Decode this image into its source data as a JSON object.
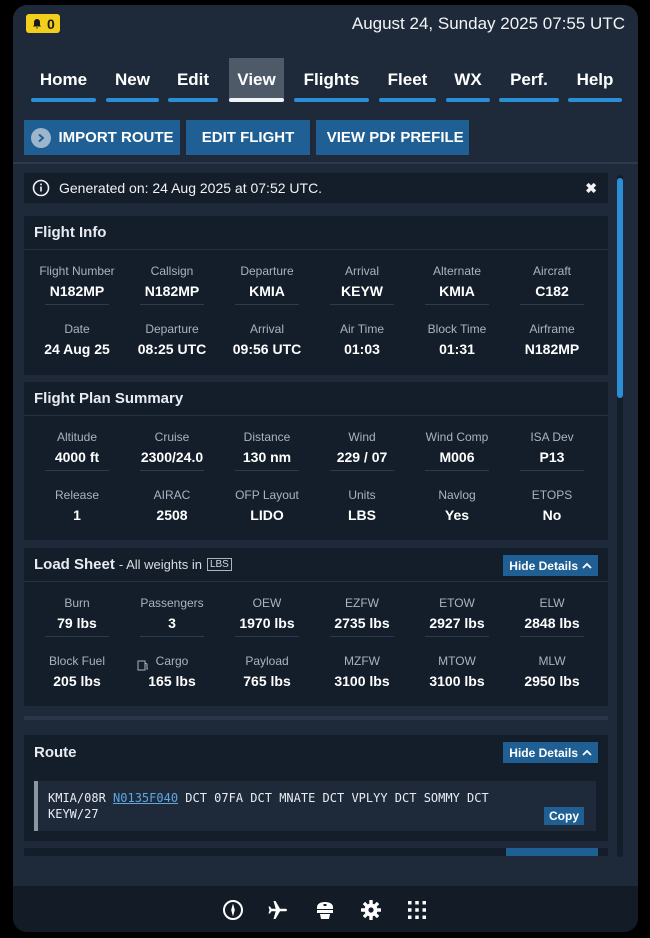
{
  "status": {
    "notification_count": "0",
    "datetime": "August 24, Sunday 2025 07:55 UTC"
  },
  "nav": {
    "items": [
      {
        "label": "Home"
      },
      {
        "label": "New"
      },
      {
        "label": "Edit"
      },
      {
        "label": "View"
      },
      {
        "label": "Flights"
      },
      {
        "label": "Fleet"
      },
      {
        "label": "WX"
      },
      {
        "label": "Perf."
      },
      {
        "label": "Help"
      }
    ],
    "active": "View"
  },
  "actions": {
    "import_route": "IMPORT ROUTE",
    "edit_flight": "EDIT FLIGHT",
    "view_pdf": "VIEW PDF",
    "prefile": "PREFILE"
  },
  "generated": {
    "text": "Generated on: 24 Aug 2025 at 07:52 UTC.",
    "close": "✖"
  },
  "flight_info": {
    "title": "Flight Info",
    "cells": [
      {
        "label": "Flight Number",
        "value": "N182MP"
      },
      {
        "label": "Callsign",
        "value": "N182MP"
      },
      {
        "label": "Departure",
        "value": "KMIA"
      },
      {
        "label": "Arrival",
        "value": "KEYW"
      },
      {
        "label": "Alternate",
        "value": "KMIA"
      },
      {
        "label": "Aircraft",
        "value": "C182"
      },
      {
        "label": "Date",
        "value": "24 Aug 25"
      },
      {
        "label": "Departure",
        "value": "08:25 UTC"
      },
      {
        "label": "Arrival",
        "value": "09:56 UTC"
      },
      {
        "label": "Air Time",
        "value": "01:03"
      },
      {
        "label": "Block Time",
        "value": "01:31"
      },
      {
        "label": "Airframe",
        "value": "N182MP"
      }
    ]
  },
  "plan_summary": {
    "title": "Flight Plan Summary",
    "cells": [
      {
        "label": "Altitude",
        "value": "4000 ft"
      },
      {
        "label": "Cruise",
        "value": "2300/24.0"
      },
      {
        "label": "Distance",
        "value": "130 nm"
      },
      {
        "label": "Wind",
        "value": "229 / 07"
      },
      {
        "label": "Wind Comp",
        "value": "M006"
      },
      {
        "label": "ISA Dev",
        "value": "P13"
      },
      {
        "label": "Release",
        "value": "1"
      },
      {
        "label": "AIRAC",
        "value": "2508"
      },
      {
        "label": "OFP Layout",
        "value": "LIDO"
      },
      {
        "label": "Units",
        "value": "LBS"
      },
      {
        "label": "Navlog",
        "value": "Yes"
      },
      {
        "label": "ETOPS",
        "value": "No"
      }
    ]
  },
  "load_sheet": {
    "title": "Load Sheet",
    "subtitle": "- All weights in",
    "unit": "LBS",
    "hide_label": "Hide Details",
    "cells": [
      {
        "label": "Burn",
        "value": "79 lbs"
      },
      {
        "label": "Passengers",
        "value": "3"
      },
      {
        "label": "OEW",
        "value": "1970 lbs"
      },
      {
        "label": "EZFW",
        "value": "2735 lbs"
      },
      {
        "label": "ETOW",
        "value": "2927 lbs"
      },
      {
        "label": "ELW",
        "value": "2848 lbs"
      },
      {
        "label": "Block Fuel",
        "value": "205 lbs"
      },
      {
        "label": "Cargo",
        "value": "165 lbs"
      },
      {
        "label": "Payload",
        "value": "765 lbs"
      },
      {
        "label": "MZFW",
        "value": "3100 lbs"
      },
      {
        "label": "MTOW",
        "value": "3100 lbs"
      },
      {
        "label": "MLW",
        "value": "2950 lbs"
      }
    ]
  },
  "route": {
    "title": "Route",
    "hide_label": "Hide Details",
    "part1": "KMIA/08R ",
    "highlight": "N0135F040",
    "part2": " DCT 07FA DCT MNATE DCT VPLYY DCT SOMMY DCT",
    "line2": "KEYW/27",
    "copy_label": "Copy"
  },
  "bottom_bar": {
    "icons": [
      "compass-icon",
      "airplane-icon",
      "pilot-cap-icon",
      "settings-gear-icon",
      "apps-grid-icon"
    ]
  }
}
